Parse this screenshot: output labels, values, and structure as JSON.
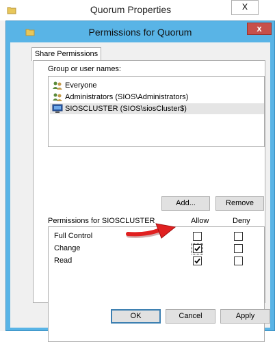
{
  "background_window": {
    "title": "Quorum Properties",
    "close_label": "x"
  },
  "dialog": {
    "title": "Permissions for Quorum",
    "close_label": "x",
    "tab_label": "Share Permissions",
    "group_label": "Group or user names:",
    "users": [
      {
        "name": "Everyone",
        "icon": "user-group-icon",
        "selected": false
      },
      {
        "name": "Administrators (SIOS\\Administrators)",
        "icon": "user-group-icon",
        "selected": false
      },
      {
        "name": "SIOSCLUSTER (SIOS\\siosCluster$)",
        "icon": "computer-icon",
        "selected": true
      }
    ],
    "add_label": "Add...",
    "remove_label": "Remove",
    "permissions_for_label": "Permissions for SIOSCLUSTER",
    "allow_header": "Allow",
    "deny_header": "Deny",
    "permissions": [
      {
        "name": "Full Control",
        "allow": false,
        "deny": false
      },
      {
        "name": "Change",
        "allow": true,
        "deny": false
      },
      {
        "name": "Read",
        "allow": true,
        "deny": false
      }
    ],
    "ok_label": "OK",
    "cancel_label": "Cancel",
    "apply_label": "Apply"
  },
  "colors": {
    "dialog_frame": "#59b4e6",
    "close_button": "#c7504a",
    "annotation_arrow": "#e02020"
  }
}
